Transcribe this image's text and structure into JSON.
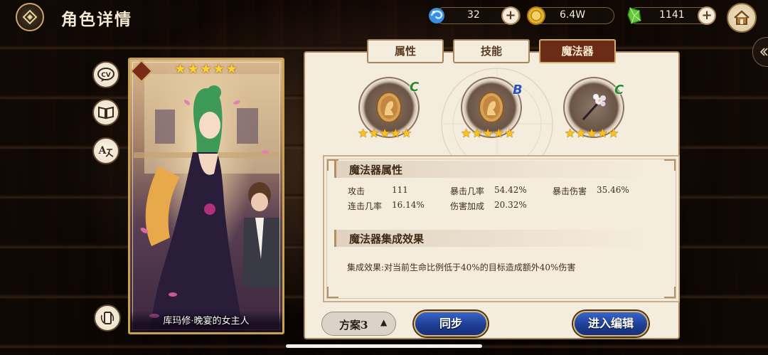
{
  "header": {
    "title": "角色详情",
    "resources": [
      {
        "name": "blue-gem",
        "icon": "blue-swirl-gem-icon",
        "value": "32"
      },
      {
        "name": "gold-coin",
        "icon": "gold-coin-icon",
        "value": "6.4W"
      },
      {
        "name": "green-crystal",
        "icon": "green-crystal-icon",
        "value": "1141"
      }
    ]
  },
  "side_buttons": [
    {
      "name": "cv-button",
      "icon": "cv-icon",
      "text": "CV"
    },
    {
      "name": "story-book-button",
      "icon": "book-icon",
      "text": ""
    },
    {
      "name": "translate-button",
      "icon": "translate-icon",
      "text": "A"
    }
  ],
  "card": {
    "stars": "★★★★★",
    "name": "库玛修·晚宴的女主人"
  },
  "tabs": [
    {
      "label": "属性",
      "active": false
    },
    {
      "label": "技能",
      "active": false
    },
    {
      "label": "魔法器",
      "active": true
    }
  ],
  "artifacts": [
    {
      "grade": "C",
      "grade_color": "#2f8a2a",
      "stars": "★★★★★",
      "icon": "gold-cameo-icon"
    },
    {
      "grade": "B",
      "grade_color": "#2a52b8",
      "stars": "★★★★★",
      "icon": "gold-cameo-icon"
    },
    {
      "grade": "C",
      "grade_color": "#2f8a2a",
      "stars": "★★★★★",
      "icon": "flower-wand-icon"
    }
  ],
  "attributes": {
    "title": "魔法器属性",
    "stats": [
      {
        "label": "攻击",
        "value": "111"
      },
      {
        "label": "暴击几率",
        "value": "54.42%"
      },
      {
        "label": "暴击伤害",
        "value": "35.46%"
      },
      {
        "label": "连击几率",
        "value": "16.14%"
      },
      {
        "label": "伤害加成",
        "value": "20.32%"
      }
    ]
  },
  "set_effect": {
    "title": "魔法器集成效果",
    "text": "集成效果:对当前生命比例低于40%的目标造成额外40%伤害"
  },
  "bottom": {
    "plan_label": "方案3",
    "plan_arrow": "▲",
    "sync_label": "同步",
    "edit_label": "进入编辑"
  },
  "colors": {
    "tab_active_bg": "#6a2c16",
    "button_blue": "#1f3f96",
    "star_gold": "#ffc21a"
  }
}
